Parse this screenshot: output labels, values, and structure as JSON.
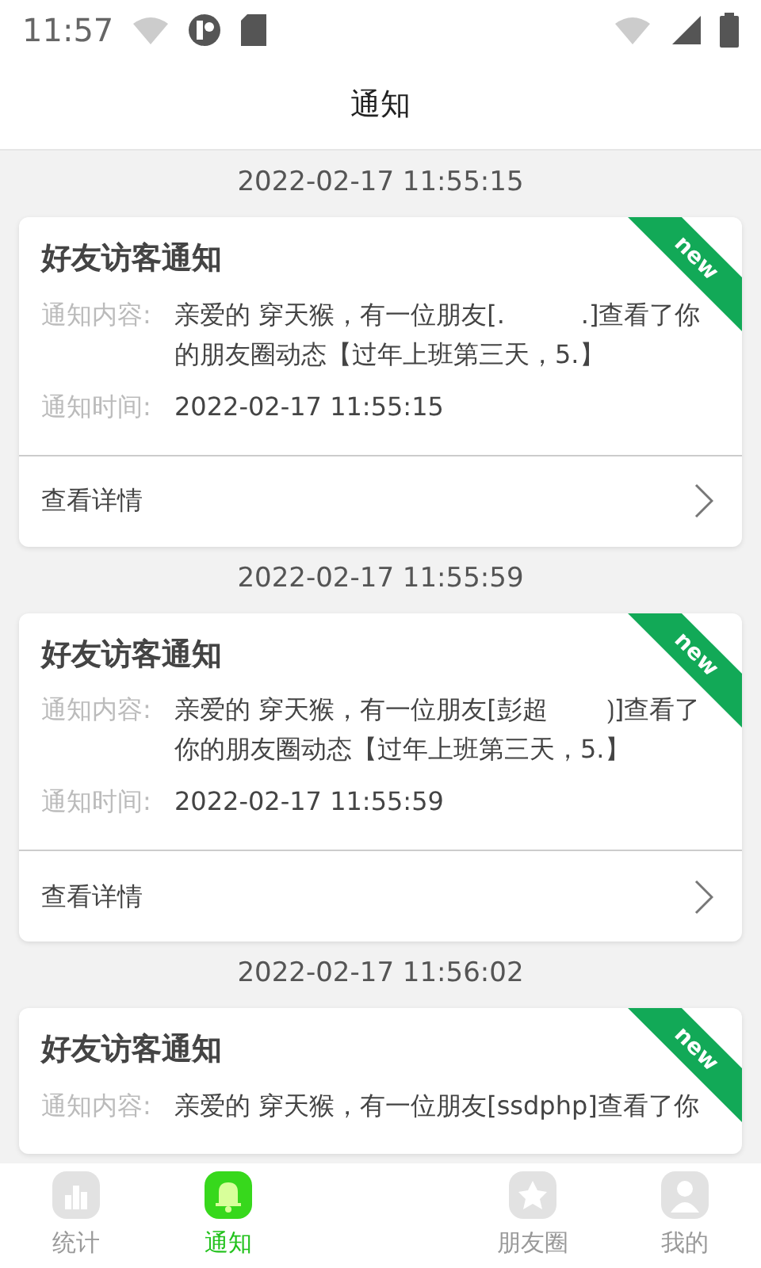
{
  "status_bar": {
    "time": "11:57"
  },
  "header": {
    "title": "通知"
  },
  "notifications": [
    {
      "date": "2022-02-17 11:55:15",
      "title": "好友访客通知",
      "is_new": true,
      "ribbon": "new",
      "content_label": "通知内容:",
      "content": "亲爱的 穿天猴，有一位朋友[.　　　.]查看了你的朋友圈动态【过年上班第三天，5.】",
      "time_label": "通知时间:",
      "time": "2022-02-17 11:55:15",
      "details": "查看详情"
    },
    {
      "date": "2022-02-17 11:55:59",
      "title": "好友访客通知",
      "is_new": true,
      "ribbon": "new",
      "content_label": "通知内容:",
      "content": "亲爱的 穿天猴，有一位朋友[彭超　　 ⟯]查看了你的朋友圈动态【过年上班第三天，5.】",
      "time_label": "通知时间:",
      "time": "2022-02-17 11:55:59",
      "details": "查看详情"
    },
    {
      "date": "2022-02-17 11:56:02",
      "title": "好友访客通知",
      "is_new": true,
      "ribbon": "new",
      "content_label": "通知内容:",
      "content": "亲爱的 穿天猴，有一位朋友[ssdphp]查看了你"
    }
  ],
  "tab_bar": [
    {
      "label": "统计",
      "kind": "stats",
      "selected": false
    },
    {
      "label": "通知",
      "kind": "bell",
      "selected": true
    },
    {
      "label": "朋友圈",
      "kind": "star",
      "selected": false
    },
    {
      "label": "我的",
      "kind": "person",
      "selected": false
    }
  ]
}
